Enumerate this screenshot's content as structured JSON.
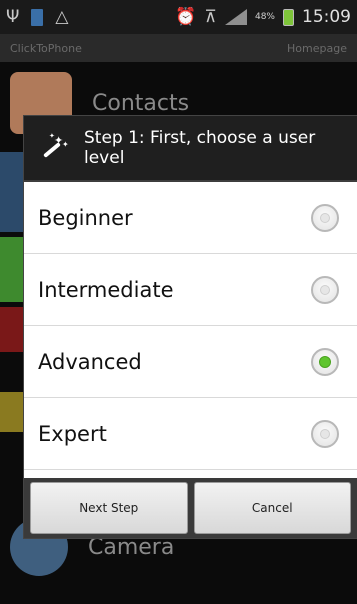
{
  "status_bar": {
    "battery_percent": "48%",
    "time": "15:09"
  },
  "app": {
    "title": "ClickToPhone",
    "menu_label": "Homepage"
  },
  "background_items": [
    {
      "label": "Contacts",
      "icon": "contacts-icon"
    },
    {
      "label": "Camera",
      "icon": "camera-icon"
    }
  ],
  "dialog": {
    "title": "Step 1: First, choose a user level",
    "icon": "magic-wand-icon",
    "options": [
      {
        "label": "Beginner",
        "checked": false
      },
      {
        "label": "Intermediate",
        "checked": false
      },
      {
        "label": "Advanced",
        "checked": true
      },
      {
        "label": "Expert",
        "checked": false
      }
    ],
    "buttons": {
      "next": "Next Step",
      "cancel": "Cancel"
    }
  },
  "colors": {
    "radio_checked": "#5fc52e",
    "dialog_header_bg": "#1f1f1f"
  }
}
